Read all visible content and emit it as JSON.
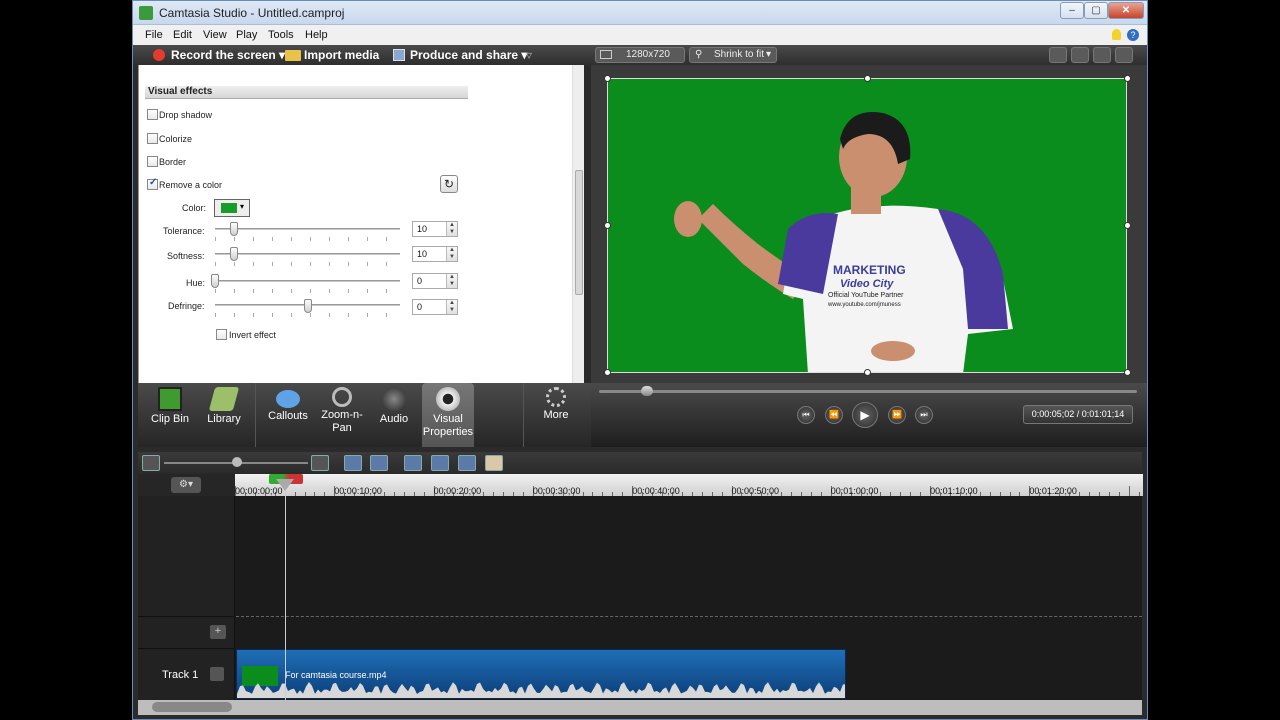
{
  "window": {
    "title": "Camtasia Studio - Untitled.camproj"
  },
  "menu": [
    "File",
    "Edit",
    "View",
    "Play",
    "Tools",
    "Help"
  ],
  "toolbar": {
    "record": "Record the screen",
    "import": "Import media",
    "produce": "Produce and share"
  },
  "preview_bar": {
    "dimensions": "1280x720",
    "zoom": "Shrink to fit"
  },
  "visual_effects": {
    "header": "Visual effects",
    "drop_shadow": "Drop shadow",
    "colorize": "Colorize",
    "border": "Border",
    "remove_color": "Remove a color",
    "color_label": "Color:",
    "tolerance_label": "Tolerance:",
    "tolerance_value": "10",
    "softness_label": "Softness:",
    "softness_value": "10",
    "hue_label": "Hue:",
    "hue_value": "0",
    "defringe_label": "Defringe:",
    "defringe_value": "0",
    "invert": "Invert effect",
    "remove_color_checked": true,
    "slider_levels": {
      "tolerance": 0.1,
      "softness": 0.1,
      "hue": 0.0,
      "defringe": 0.5
    }
  },
  "tabs": {
    "clip_bin": "Clip Bin",
    "library": "Library",
    "callouts": "Callouts",
    "zoom_pan_1": "Zoom-n-",
    "zoom_pan_2": "Pan",
    "audio": "Audio",
    "visual_1": "Visual",
    "visual_2": "Properties",
    "more": "More"
  },
  "video_text": {
    "line1": "MARKETING",
    "line2": "Video City",
    "line3": "Official YouTube Partner",
    "line4": "www.youtube.com/jmuness"
  },
  "transport": {
    "time": "0:00:05;02 / 0:01:01;14"
  },
  "timeline": {
    "playhead_time": "0:00:05;02",
    "ruler_labels": [
      "00:00:00;00",
      "00:00:10;00",
      "00:00:20;00",
      "00:00:30;00",
      "00:00:40;00",
      "00:00:50;00",
      "00:01:00;00",
      "00:01:10;00",
      "00:01:20;00"
    ],
    "track_name": "Track 1",
    "clip_name": "For camtasia course.mp4"
  },
  "colors": {
    "greenscreen": "#0a8d1c",
    "clip": "#1f6fb6",
    "record": "#e33b2e"
  }
}
